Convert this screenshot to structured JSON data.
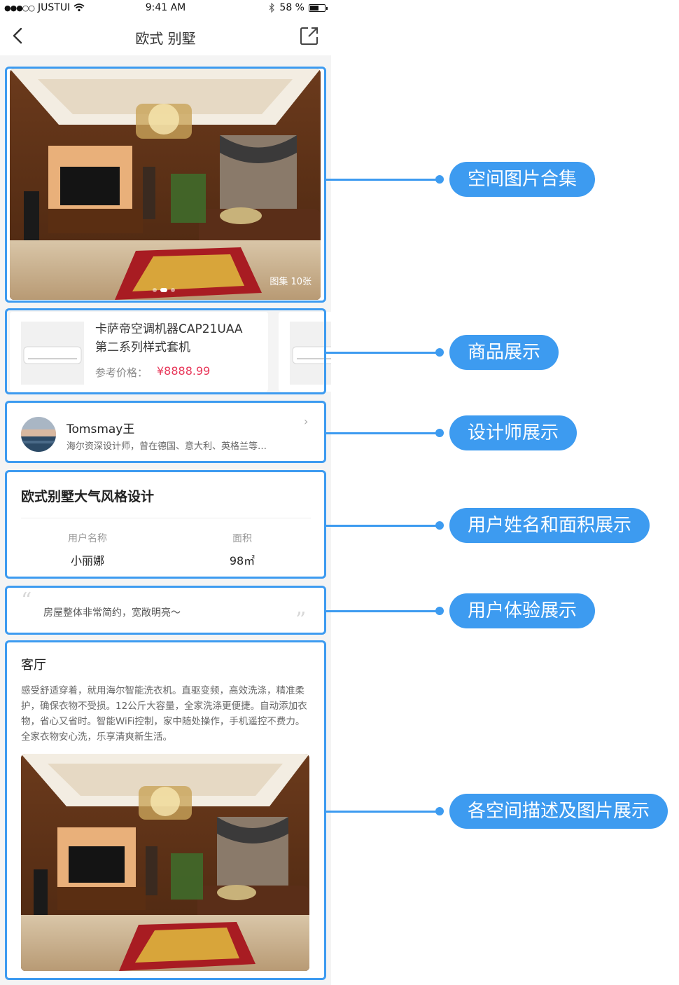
{
  "status_bar": {
    "carrier": "JUSTUI",
    "time": "9:41 AM",
    "battery": "58 %",
    "battery_level": 0.58
  },
  "nav": {
    "title": "欧式 别墅"
  },
  "hero": {
    "gallery_count": "图集 10张",
    "page_count": 3,
    "active_page": 2
  },
  "products": {
    "items": [
      {
        "name_line1": "卡萨帝空调机器CAP21UAA",
        "name_line2": "第二系列样式套机",
        "price_label": "参考价格：",
        "price": "¥8888.99"
      }
    ]
  },
  "designer": {
    "name": "Tomsmay王",
    "description": "海尔资深设计师，曾在德国、意大利、英格兰等…"
  },
  "project": {
    "title": "欧式别墅大气风格设计",
    "user_label": "用户名称",
    "user_value": "小丽娜",
    "area_label": "面积",
    "area_value": "98㎡"
  },
  "review": {
    "text": "房屋整体非常简约，宽敞明亮～"
  },
  "room": {
    "title": "客厅",
    "description": "感受舒适穿着，就用海尔智能洗衣机。直驱变频，高效洗涤，精准柔护，确保衣物不受损。12公斤大容量，全家洗涤更便捷。自动添加衣物，省心又省时。智能WiFi控制，家中随处操作，手机遥控不费力。全家衣物安心洗，乐享清爽新生活。"
  },
  "annotations": [
    "空间图片合集",
    "商品展示",
    "设计师展示",
    "用户姓名和面积展示",
    "用户体验展示",
    "各空间描述及图片展示"
  ],
  "colors": {
    "accent": "#3d9bf0",
    "price": "#e8385a"
  }
}
